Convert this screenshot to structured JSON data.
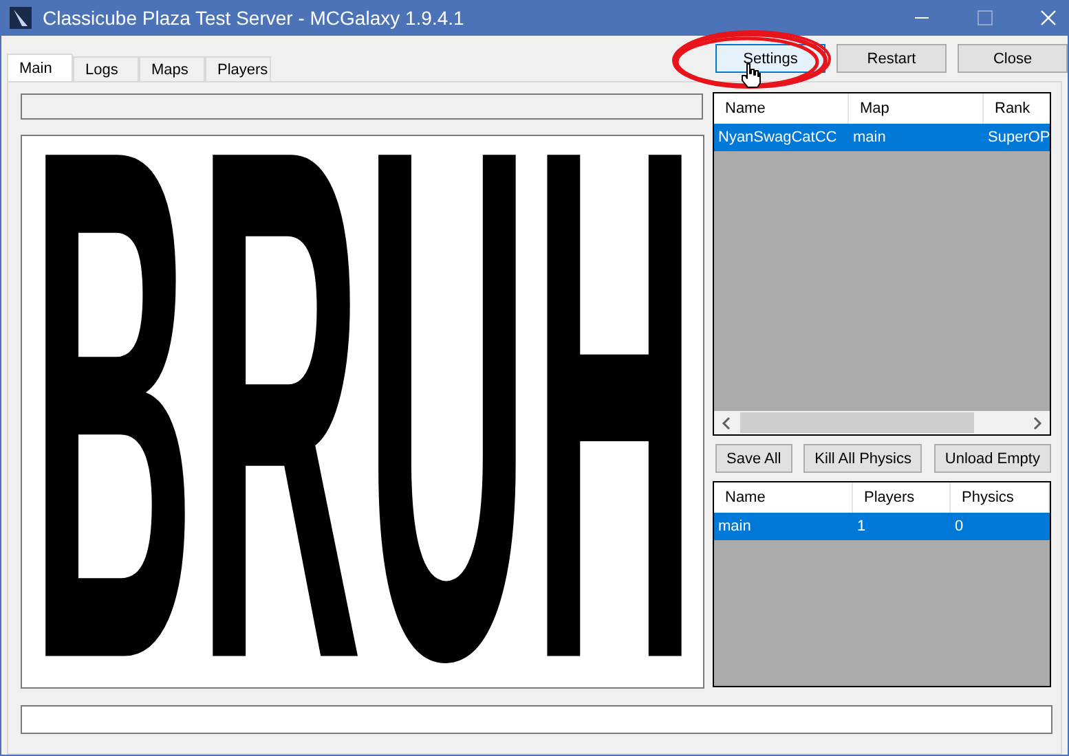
{
  "window": {
    "title": "Classicube Plaza Test Server - MCGalaxy 1.9.4.1"
  },
  "tabs": [
    {
      "label": "Main",
      "selected": true
    },
    {
      "label": "Logs",
      "selected": false
    },
    {
      "label": "Maps",
      "selected": false
    },
    {
      "label": "Players",
      "selected": false
    }
  ],
  "top_buttons": [
    {
      "label": "Settings",
      "selected": true
    },
    {
      "label": "Restart",
      "selected": false
    },
    {
      "label": "Close",
      "selected": false
    }
  ],
  "overlay_image": {
    "text": "BRUH"
  },
  "players_table": {
    "columns": [
      "Name",
      "Map",
      "Rank"
    ],
    "rows": [
      {
        "cells": [
          "NyanSwagCatCC",
          "main",
          "SuperOP"
        ],
        "selected": true
      }
    ]
  },
  "map_buttons": [
    "Save All",
    "Kill All Physics",
    "Unload Empty"
  ],
  "maps_table": {
    "columns": [
      "Name",
      "Players",
      "Physics"
    ],
    "rows": [
      {
        "cells": [
          "main",
          "1",
          "0"
        ],
        "selected": true
      }
    ]
  }
}
